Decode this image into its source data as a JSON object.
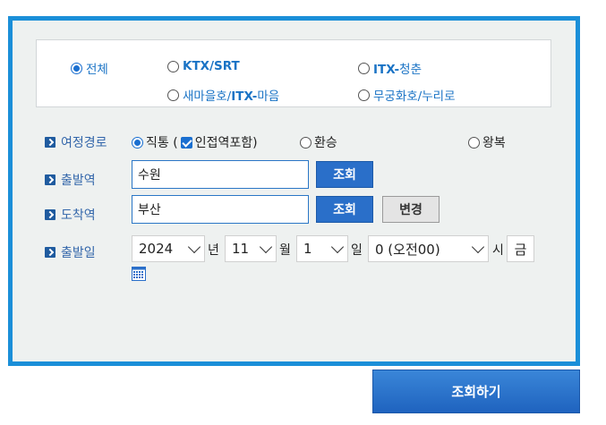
{
  "train_types": {
    "all": "전체",
    "ktx_srt": "KTX/SRT",
    "itx_cheongchun": {
      "prefix": "ITX-",
      "suffix": "청춘"
    },
    "saemaeul": {
      "prefix": "새마을호/",
      "bold": "ITX-",
      "suffix": "마음"
    },
    "mugunghwa": "무궁화호/누리로"
  },
  "route": {
    "label": "여정경로",
    "direct": "직통 (",
    "adjacent": "인접역포함)",
    "transfer": "환승",
    "round_trip": "왕복"
  },
  "departure": {
    "label": "출발역",
    "value": "수원",
    "search_label": "조회"
  },
  "arrival": {
    "label": "도착역",
    "value": "부산",
    "search_label": "조회",
    "swap_label": "변경"
  },
  "date": {
    "label": "출발일",
    "year": "2024",
    "year_unit": "년",
    "month": "11",
    "month_unit": "월",
    "day": "1",
    "day_unit": "일",
    "hour": "0 (오전00)",
    "hour_unit": "시",
    "weekday": "금"
  },
  "search_button": "조회하기",
  "colors": {
    "accent": "#1b8fd8",
    "button": "#2a6fc9",
    "label": "#3366aa"
  }
}
